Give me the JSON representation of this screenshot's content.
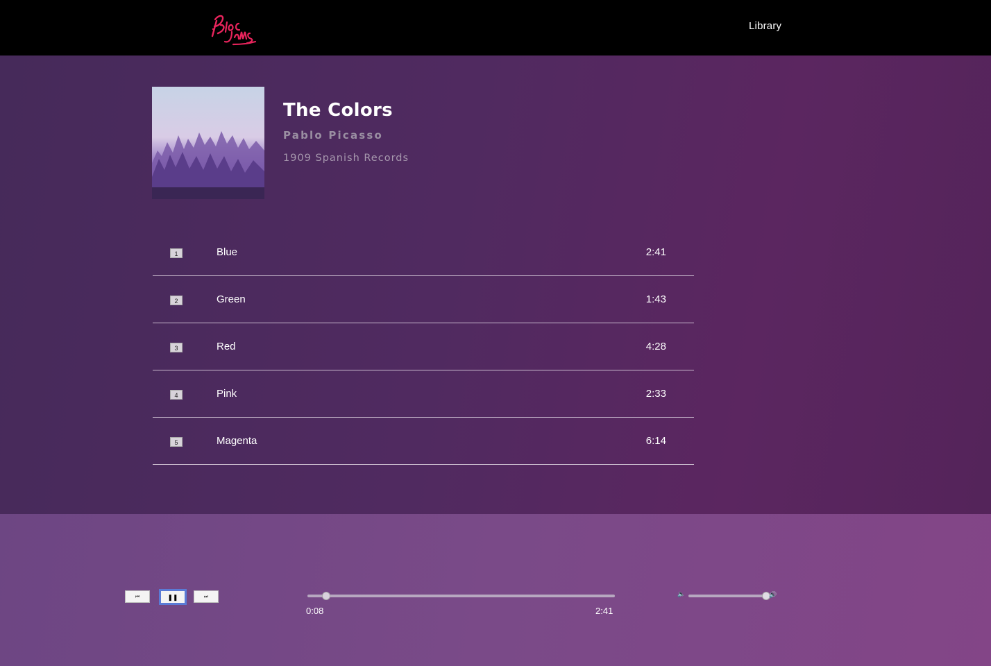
{
  "nav": {
    "logo_text": "Bloc Jams",
    "library_label": "Library"
  },
  "album": {
    "title": "The Colors",
    "artist": "Pablo Picasso",
    "release": "1909 Spanish Records",
    "songs": [
      {
        "number": "1",
        "title": "Blue",
        "duration": "2:41"
      },
      {
        "number": "2",
        "title": "Green",
        "duration": "1:43"
      },
      {
        "number": "3",
        "title": "Red",
        "duration": "4:28"
      },
      {
        "number": "4",
        "title": "Pink",
        "duration": "2:33"
      },
      {
        "number": "5",
        "title": "Magenta",
        "duration": "6:14"
      }
    ]
  },
  "player": {
    "prev_icon": "skip-back-icon",
    "play_state_icon": "pause-icon",
    "next_icon": "skip-forward-icon",
    "current_time": "0:08",
    "total_time": "2:41",
    "progress": 0.06,
    "volume": 0.97
  },
  "colors": {
    "logo_pink": "#e8245c",
    "navbar": "#000000",
    "accent_focus": "#5a7bd6"
  }
}
